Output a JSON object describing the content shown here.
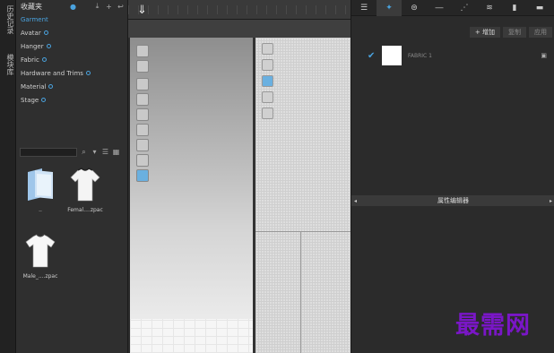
{
  "left_strip": {
    "tabs": [
      "历史记录",
      "模块库"
    ]
  },
  "library": {
    "title": "收藏夹",
    "tree": [
      {
        "label": "Garment",
        "selected": true,
        "dot": false
      },
      {
        "label": "Avatar",
        "dot": true
      },
      {
        "label": "Hanger",
        "dot": true
      },
      {
        "label": "Fabric",
        "dot": true
      },
      {
        "label": "Hardware and Trims",
        "dot": true
      },
      {
        "label": "Material",
        "dot": true
      },
      {
        "label": "Stage",
        "dot": true
      }
    ],
    "files": [
      {
        "name": "..",
        "icon": "folder-icon"
      },
      {
        "name": "Femal....zpac",
        "icon": "shirt-icon"
      },
      {
        "name": "Male_....zpac",
        "icon": "shirt-icon"
      }
    ]
  },
  "right": {
    "actions": {
      "add": "+ 增加",
      "copy": "复制",
      "apply": "应用"
    },
    "fabric": {
      "name": "FABRIC 1",
      "swatch_color": "#ffffff"
    },
    "property_editor": "属性编辑器"
  },
  "watermark": "最需网",
  "colors": {
    "accent": "#4aa3df",
    "watermark": "#7a16c7"
  }
}
